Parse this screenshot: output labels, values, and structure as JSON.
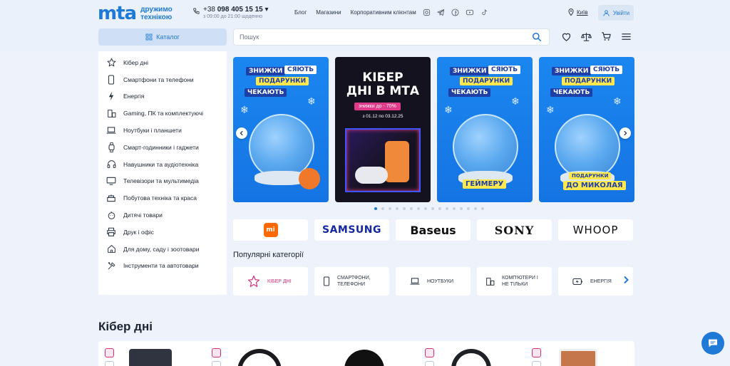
{
  "header": {
    "logo": "mta",
    "slogan_line1": "дружимо",
    "slogan_line2": "технікою",
    "phone_prefix": "+38",
    "phone_number": "098 405 15 15",
    "phone_hours": "з 09:00 до 21:00 щоденно",
    "nav": [
      "Блог",
      "Магазини",
      "Корпоративним клієнтам"
    ],
    "city": "Київ",
    "login_label": "Увійти"
  },
  "catalog_label": "Каталог",
  "search": {
    "placeholder": "Пошук"
  },
  "sidebar": {
    "items": [
      {
        "label": "Кібер дні",
        "icon": "star-icon"
      },
      {
        "label": "Смартфони та телефони",
        "icon": "smartphone-icon"
      },
      {
        "label": "Енергія",
        "icon": "lightning-icon"
      },
      {
        "label": "Gaming, ПК та комплектуючі",
        "icon": "pc-icon"
      },
      {
        "label": "Ноутбуки і планшети",
        "icon": "laptop-icon"
      },
      {
        "label": "Смарт-годинники і гаджети",
        "icon": "watch-icon"
      },
      {
        "label": "Навушники та аудіотехніка",
        "icon": "headphones-icon"
      },
      {
        "label": "Телевізори та мультимедіа",
        "icon": "tv-icon"
      },
      {
        "label": "Побутова техніка та краса",
        "icon": "appliance-icon"
      },
      {
        "label": "Дитячі товари",
        "icon": "baby-icon"
      },
      {
        "label": "Друк і офіс",
        "icon": "printer-icon"
      },
      {
        "label": "Для дому, саду і зоотовари",
        "icon": "home-icon"
      },
      {
        "label": "Інструменти та автотовари",
        "icon": "tools-icon"
      }
    ]
  },
  "banners": [
    {
      "line1": "ЗНИЖКИ",
      "line2": "СЯЮТЬ",
      "line3": "ПОДАРУНКИ",
      "line4": "ЧЕКАЮТЬ",
      "tag": ""
    },
    {
      "title1": "КІБЕР",
      "title2": "ДНІ В МТА",
      "discount": "знижки до - 70%",
      "dates": "з 01.12 по 03.12.25"
    },
    {
      "line1": "ЗНИЖКИ",
      "line2": "СЯЮТЬ",
      "line3": "ПОДАРУНКИ",
      "line4": "ЧЕКАЮТЬ",
      "tag": "ГЕЙМЕРУ"
    },
    {
      "line1": "ЗНИЖКИ",
      "line2": "СЯЮТЬ",
      "line3": "ПОДАРУНКИ",
      "line4": "ЧЕКАЮТЬ",
      "tag1": "ПОДАРУНКИ",
      "tag2": "ДО МИКОЛАЯ"
    }
  ],
  "slider_dots": 16,
  "slider_active": 0,
  "brands": [
    "mi",
    "SAMSUNG",
    "Baseus",
    "SONY",
    "WHOOP"
  ],
  "popular_title": "Популярні категорії",
  "popular": [
    {
      "label": "КІБЕР ДНІ"
    },
    {
      "label": "СМАРТФОНИ, ТЕЛЕФОНИ"
    },
    {
      "label": "НОУТБУКИ"
    },
    {
      "label": "КОМП'ЮТЕРИ І НЕ ТІЛЬКИ"
    },
    {
      "label": "ЕНЕРГІЯ"
    }
  ],
  "cyber_title": "Кібер дні",
  "colors": {
    "accent": "#1f79d6",
    "pink": "#d4317a",
    "bg": "#eef3fb"
  }
}
